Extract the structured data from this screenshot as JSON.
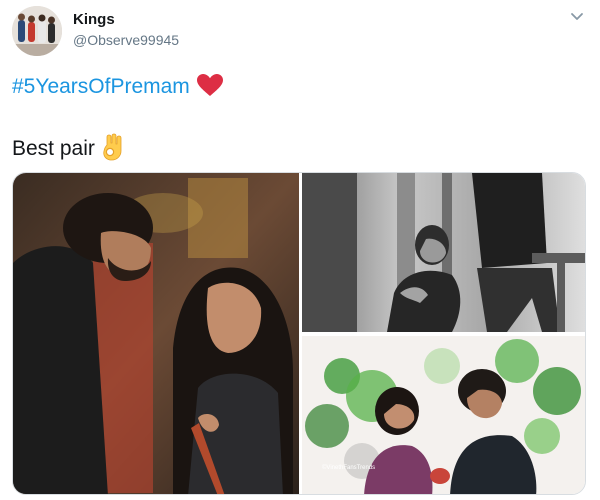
{
  "author": {
    "display_name": "Kings",
    "handle": "@Observe99945"
  },
  "tweet": {
    "hashtag": "#5YearsOfPremam",
    "heart_icon": "red-heart-emoji",
    "text": "Best pair",
    "ok_icon": "ok-hand-emoji"
  },
  "colors": {
    "link": "#1b95e0",
    "text": "#14171a",
    "secondary": "#657786",
    "border": "#d8dde1"
  },
  "media": {
    "watermark": "©VinethFansTrends"
  }
}
